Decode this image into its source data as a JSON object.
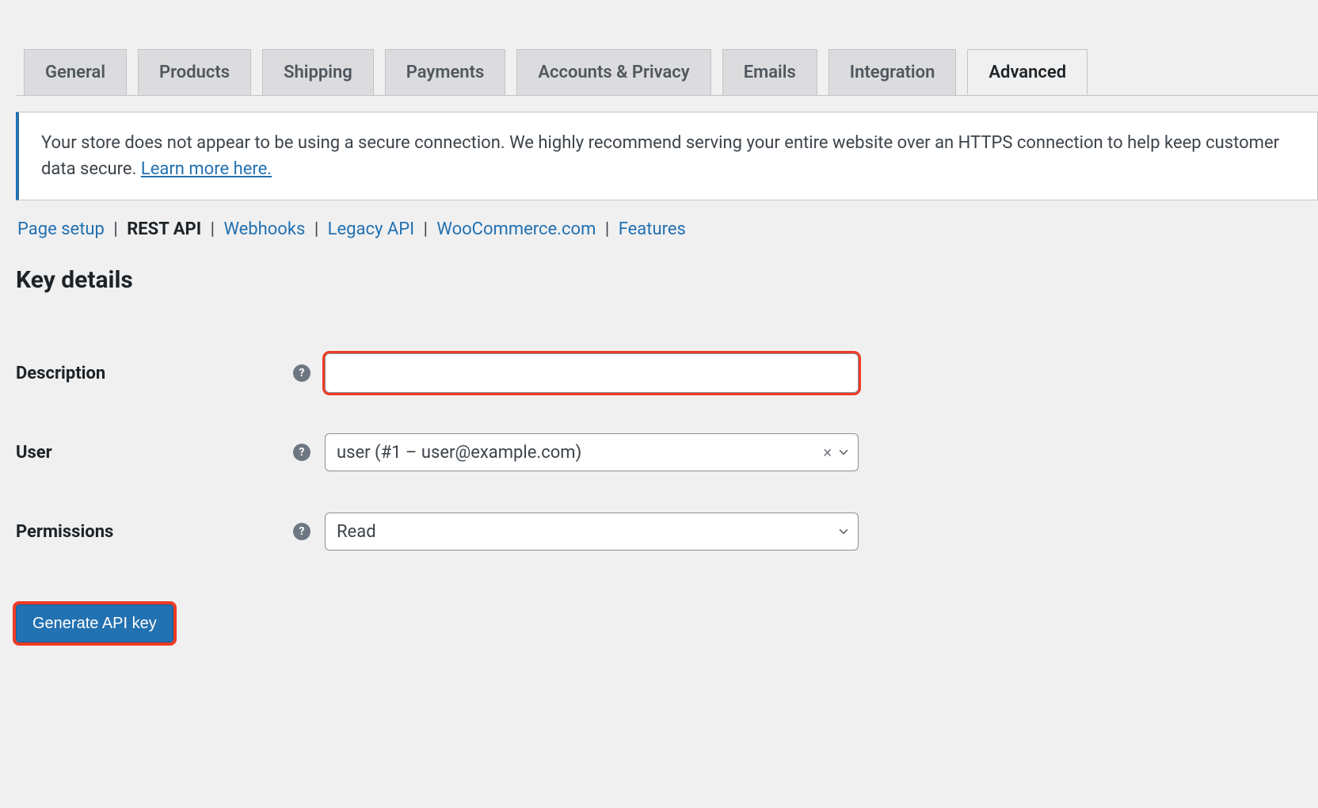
{
  "tabs": [
    {
      "label": "General",
      "active": false
    },
    {
      "label": "Products",
      "active": false
    },
    {
      "label": "Shipping",
      "active": false
    },
    {
      "label": "Payments",
      "active": false
    },
    {
      "label": "Accounts & Privacy",
      "active": false
    },
    {
      "label": "Emails",
      "active": false
    },
    {
      "label": "Integration",
      "active": false
    },
    {
      "label": "Advanced",
      "active": true
    }
  ],
  "notice": {
    "text_before": "Your store does not appear to be using a secure connection. We highly recommend serving your entire website over an HTTPS connection to help keep customer data secure. ",
    "link_text": "Learn more here."
  },
  "subnav": [
    {
      "label": "Page setup",
      "current": false
    },
    {
      "label": "REST API",
      "current": true
    },
    {
      "label": "Webhooks",
      "current": false
    },
    {
      "label": "Legacy API",
      "current": false
    },
    {
      "label": "WooCommerce.com",
      "current": false
    },
    {
      "label": "Features",
      "current": false
    }
  ],
  "heading": "Key details",
  "form": {
    "description": {
      "label": "Description",
      "value": ""
    },
    "user": {
      "label": "User",
      "value": "user (#1 – user@example.com)"
    },
    "permissions": {
      "label": "Permissions",
      "value": "Read"
    }
  },
  "button": {
    "label": "Generate API key"
  },
  "help_glyph": "?"
}
